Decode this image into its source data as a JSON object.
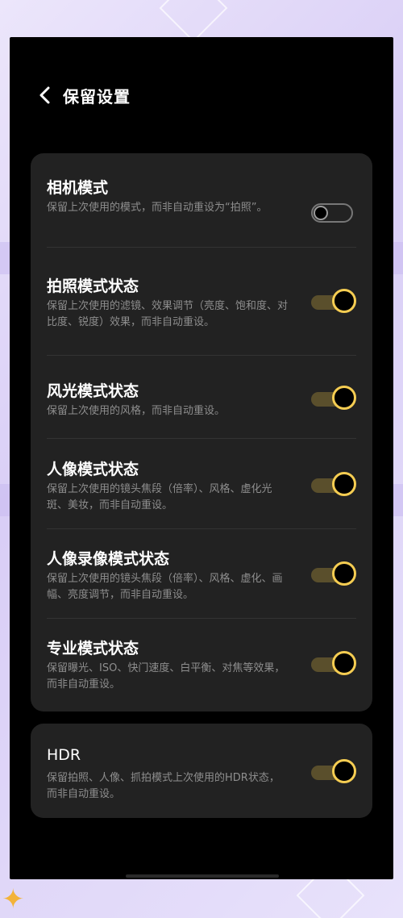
{
  "header": {
    "title": "保留设置"
  },
  "settings": [
    {
      "title": "相机模式",
      "desc": "保留上次使用的模式，而非自动重设为“拍照”。",
      "enabled": false
    },
    {
      "title": "拍照模式状态",
      "desc": "保留上次使用的滤镜、效果调节（亮度、饱和度、对比度、锐度）效果，而非自动重设。",
      "enabled": true
    },
    {
      "title": "风光模式状态",
      "desc": "保留上次使用的风格，而非自动重设。",
      "enabled": true
    },
    {
      "title": "人像模式状态",
      "desc": "保留上次使用的镜头焦段（倍率）、风格、虚化光斑、美妆，而非自动重设。",
      "enabled": true
    },
    {
      "title": "人像录像模式状态",
      "desc": "保留上次使用的镜头焦段（倍率）、风格、虚化、画幅、亮度调节，而非自动重设。",
      "enabled": true
    },
    {
      "title": "专业模式状态",
      "desc": "保留曝光、ISO、快门速度、白平衡、对焦等效果，而非自动重设。",
      "enabled": true
    }
  ],
  "hdr": {
    "title": "HDR",
    "desc": "保留拍照、人像、抓拍模式上次使用的HDR状态，而非自动重设。",
    "enabled": true
  },
  "colors": {
    "accent": "#f5cd52",
    "card": "#222222",
    "background": "#000000"
  }
}
